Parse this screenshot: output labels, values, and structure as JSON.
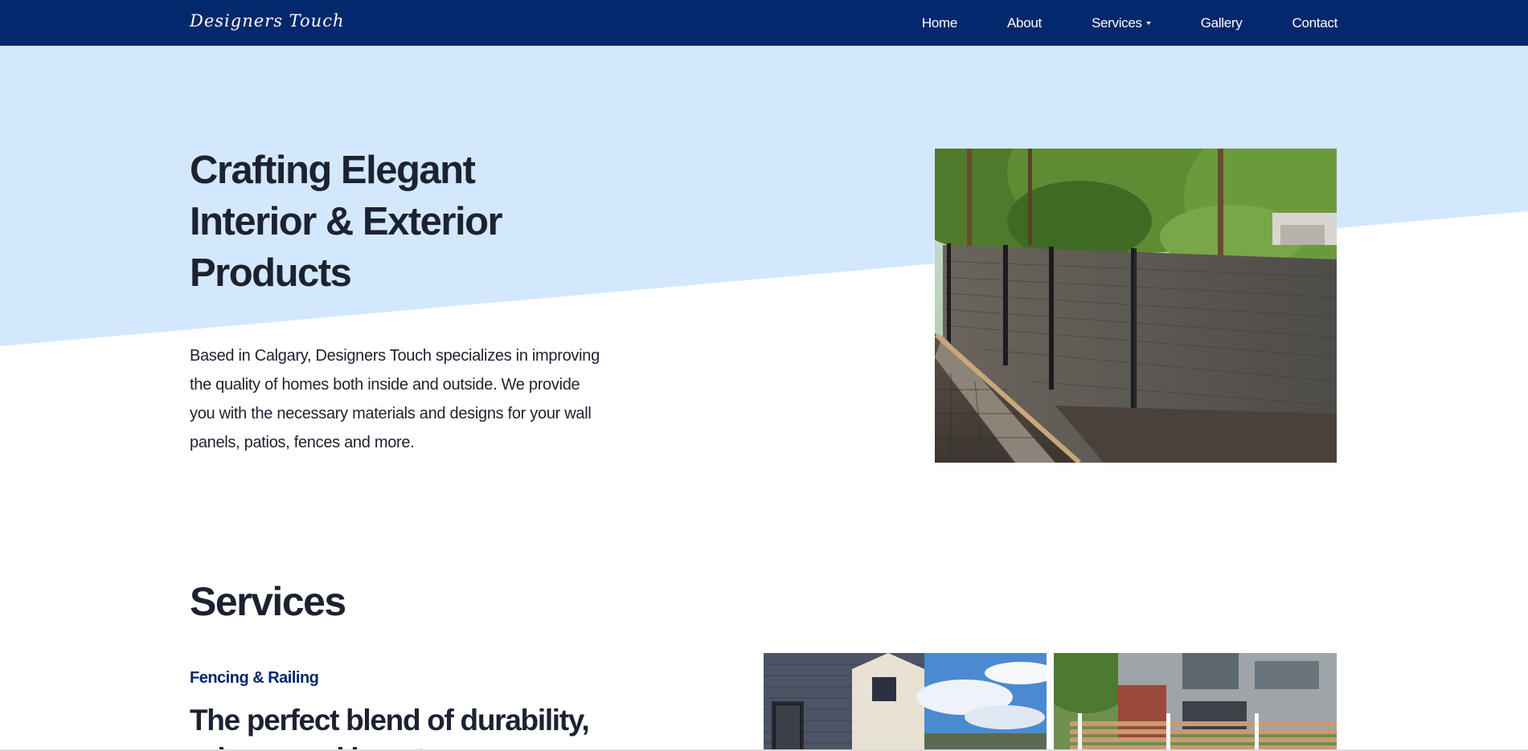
{
  "brand": {
    "name": "Designers Touch"
  },
  "nav": {
    "items": [
      {
        "label": "Home"
      },
      {
        "label": "About"
      },
      {
        "label": "Services"
      },
      {
        "label": "Gallery"
      },
      {
        "label": "Contact"
      }
    ]
  },
  "hero": {
    "title_line1": "Crafting Elegant",
    "title_line2": "Interior & Exterior",
    "title_line3": "Products",
    "description": "Based in Calgary, Designers Touch specializes in improving the quality of homes both inside and outside. We provide you with the necessary materials and designs for your wall panels, patios, fences and more."
  },
  "services": {
    "title": "Services",
    "category": "Fencing & Railing",
    "heading": "The perfect blend of durability, privacy and beauty"
  },
  "colors": {
    "navbar": "#03286b",
    "hero_band": "#d4e8fd",
    "text": "#1c2230",
    "accent": "#03286b"
  }
}
